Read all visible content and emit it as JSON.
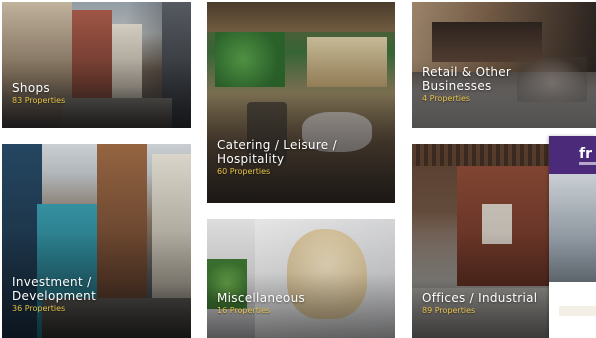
{
  "categories": [
    {
      "id": "shops",
      "title": "Shops",
      "count": "83 Properties"
    },
    {
      "id": "catering",
      "title": "Catering / Leisure /\nHospitality",
      "count": "60 Properties"
    },
    {
      "id": "retail",
      "title": "Retail & Other\nBusinesses",
      "count": "4 Properties"
    },
    {
      "id": "investment",
      "title": "Investment /\nDevelopment",
      "count": "36 Properties"
    },
    {
      "id": "misc",
      "title": "Miscellaneous",
      "count": "16 Properties"
    },
    {
      "id": "offices",
      "title": "Offices / Industrial",
      "count": "89 Properties"
    }
  ],
  "side_card": {
    "brand": "fr"
  },
  "colors": {
    "count_text": "#e8c44a",
    "title_text": "#ffffff",
    "side_card_band": "#4a2a79"
  }
}
